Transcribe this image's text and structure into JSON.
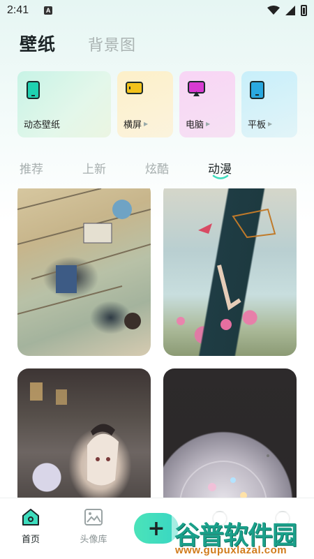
{
  "status": {
    "time": "2:41",
    "notification_badge": "A"
  },
  "top_tabs": [
    {
      "label": "壁纸",
      "active": true
    },
    {
      "label": "背景图",
      "active": false
    }
  ],
  "categories": [
    {
      "label": "动态壁纸",
      "icon": "phone-icon",
      "accent": "#1fd1b0"
    },
    {
      "label": "横屏",
      "icon": "landscape-icon",
      "accent": "#f2c21b"
    },
    {
      "label": "电脑",
      "icon": "monitor-icon",
      "accent": "#d83bd1"
    },
    {
      "label": "平板",
      "icon": "tablet-icon",
      "accent": "#2aa9e0"
    }
  ],
  "sub_tabs": [
    {
      "label": "推荐",
      "active": false
    },
    {
      "label": "上新",
      "active": false
    },
    {
      "label": "炫酷",
      "active": false
    },
    {
      "label": "动漫",
      "active": true
    }
  ],
  "wallpapers": [
    {
      "name": "anime-classroom"
    },
    {
      "name": "anime-girl-flowers"
    },
    {
      "name": "anime-gothic-girl"
    },
    {
      "name": "crystal-ball"
    }
  ],
  "bottom_nav": [
    {
      "label": "首页",
      "icon": "home-icon",
      "active": true
    },
    {
      "label": "头像库",
      "icon": "image-icon",
      "active": false
    }
  ],
  "fab": {
    "label": "+"
  },
  "watermark": {
    "logo": "谷普软件园",
    "url": "www.gupuxlazal.com"
  },
  "colors": {
    "accent": "#3ddcbd",
    "text_primary": "#1c2426",
    "text_muted": "#a6aeae"
  }
}
